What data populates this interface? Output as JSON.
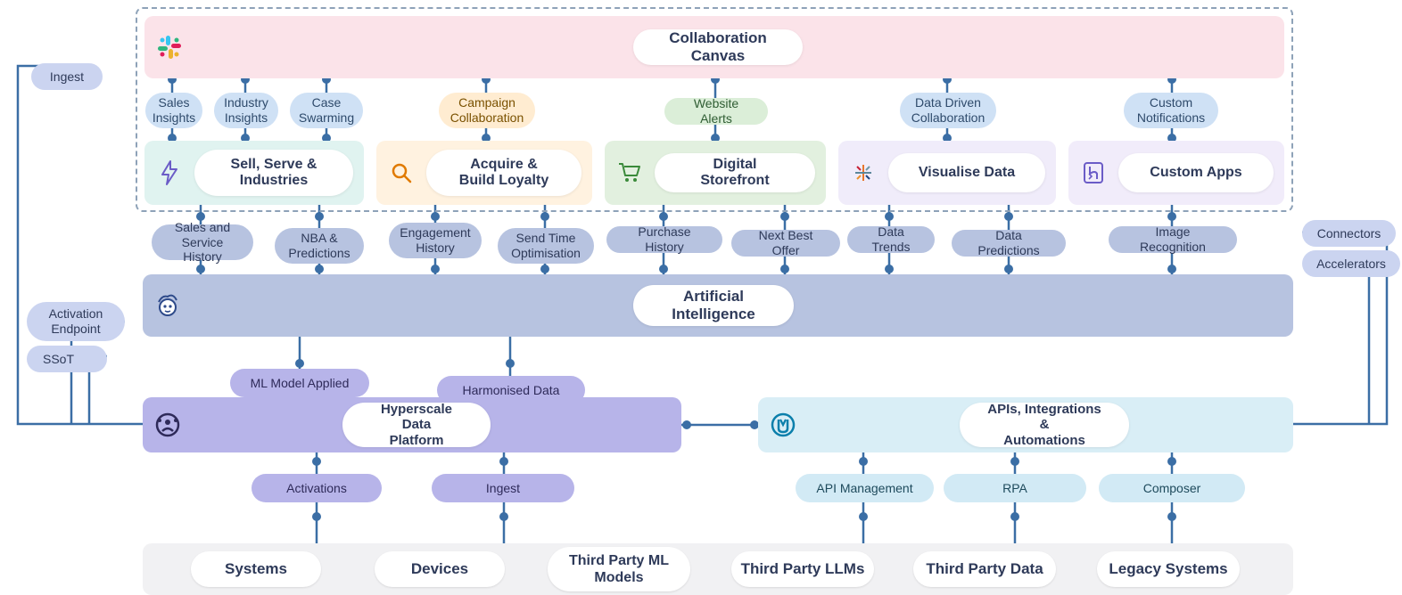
{
  "left": {
    "ingest": "Ingest",
    "activation_endpoint": "Activation\nEndpoint",
    "ssot": "SSoT"
  },
  "right": {
    "connectors": "Connectors",
    "accelerators": "Accelerators"
  },
  "collab_canvas": "Collaboration Canvas",
  "collab_tags": {
    "sales_insights": "Sales\nInsights",
    "industry_insights": "Industry\nInsights",
    "case_swarming": "Case\nSwarming",
    "campaign_collab": "Campaign\nCollaboration",
    "website_alerts": "Website Alerts",
    "data_collab": "Data Driven\nCollaboration",
    "custom_notif": "Custom\nNotifications"
  },
  "clouds": {
    "sell": "Sell, Serve &\nIndustries",
    "acquire": "Acquire &\nBuild Loyalty",
    "store": "Digital Storefront",
    "viz": "Visualise Data",
    "custom": "Custom Apps"
  },
  "ai_row_title": "Artificial Intelligence",
  "ai_tags": {
    "sales_history": "Sales and\nService History",
    "nba": "NBA &\nPredictions",
    "eng_history": "Engagement\nHistory",
    "send_time": "Send Time\nOptimisation",
    "purchase": "Purchase History",
    "nbo": "Next Best Offer",
    "trends": "Data Trends",
    "pred": "Data Predictions",
    "image": "Image Recognition"
  },
  "platform_tags": {
    "ml_applied": "ML Model Applied",
    "harmonised": "Harmonised Data"
  },
  "platforms": {
    "hyperscale": "Hyperscale Data\nPlatform",
    "apis": "APIs, Integrations &\nAutomations"
  },
  "bottom_tags": {
    "activations": "Activations",
    "ingest": "Ingest",
    "apim": "API Management",
    "rpa": "RPA",
    "composer": "Composer"
  },
  "bottom_row": {
    "systems": "Systems",
    "devices": "Devices",
    "tpml": "Third Party ML\nModels",
    "tpllm": "Third Party LLMs",
    "tpdata": "Third Party Data",
    "legacy": "Legacy Systems"
  },
  "icons": {
    "slack": "slack",
    "lightning": "lightning",
    "search": "search",
    "cart": "cart",
    "tableau": "tableau",
    "heroku": "heroku",
    "einstein": "einstein",
    "cdp": "cdp",
    "mulesoft": "mulesoft"
  }
}
